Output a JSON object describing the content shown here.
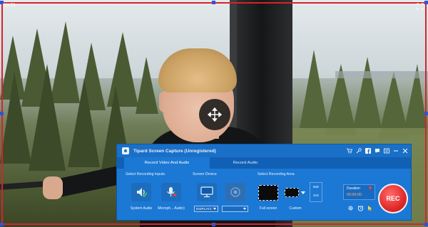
{
  "overlay": {
    "corner_label": "00173",
    "expand_icon": "expand-icon",
    "move_icon": "move-arrows-icon"
  },
  "app": {
    "title": "Tipard Screen Capture (Unregistered)",
    "titlebar_icons": [
      "cart-icon",
      "key-icon",
      "facebook-icon",
      "chat-icon",
      "menu-icon",
      "minimize-icon",
      "close-icon"
    ],
    "tabs": [
      {
        "label": "Record Video And Audio",
        "active": true
      },
      {
        "label": "Record Audio",
        "active": false
      }
    ]
  },
  "inputs": {
    "heading": "Select Recording Inputs",
    "system_audio_label": "System Audio",
    "microphone_label": "Microph... Audio)"
  },
  "device": {
    "heading": "Screen Device",
    "display_value": "DISPLAY1",
    "webcam_value": ""
  },
  "area": {
    "heading": "Select Recording Area",
    "full_screen_label": "Full screen",
    "custom_label": "Custom",
    "width": "848",
    "height": "416"
  },
  "duration": {
    "label": "Duration",
    "value": "00:00:00"
  },
  "controls": {
    "rec_label": "REC",
    "settings_icon": "gear-icon",
    "alarm_icon": "alarm-clock-icon",
    "cursor_icon": "cursor-icon"
  },
  "colors": {
    "panel": "#1b78d4",
    "region_border": "#d8232a",
    "rec": "#e12a2a"
  }
}
